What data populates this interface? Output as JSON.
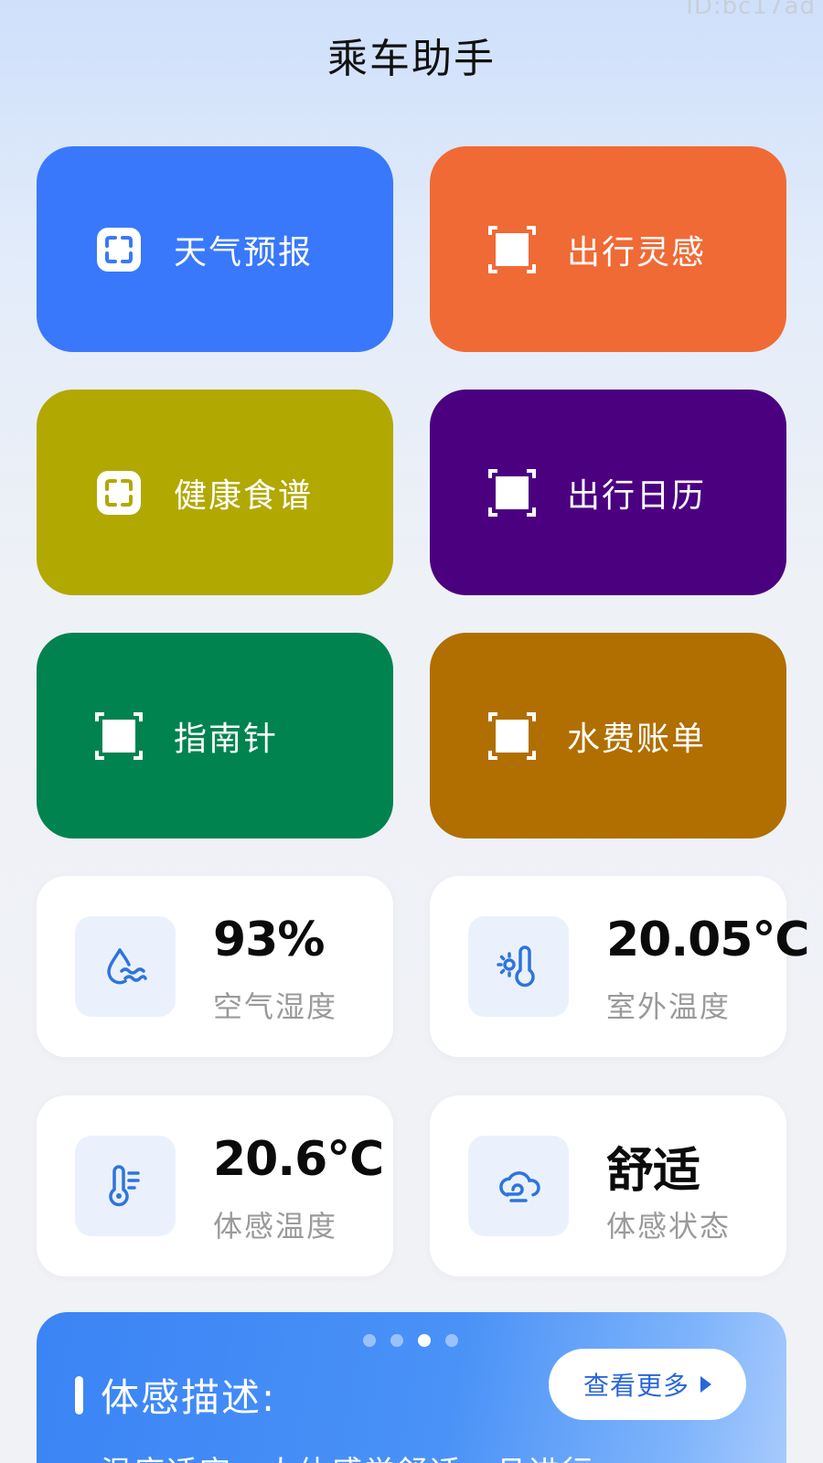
{
  "watermark": "ID:bc17ad",
  "app_title": "乘车助手",
  "tiles": [
    {
      "label": "天气预报",
      "color": "#3a78fb",
      "icon": "scan-frame-icon"
    },
    {
      "label": "出行灵感",
      "color": "#f06a35",
      "icon": "crop-square-icon"
    },
    {
      "label": "健康食谱",
      "color": "#b2a802",
      "icon": "scan-frame-icon"
    },
    {
      "label": "出行日历",
      "color": "#4b0080",
      "icon": "crop-square-icon"
    },
    {
      "label": "指南针",
      "color": "#00834f",
      "icon": "crop-square-icon"
    },
    {
      "label": "水费账单",
      "color": "#b06f00",
      "icon": "crop-square-icon"
    }
  ],
  "stats": [
    {
      "value": "93%",
      "label": "空气湿度",
      "icon": "humidity-drop-icon"
    },
    {
      "value": "20.05℃",
      "label": "室外温度",
      "icon": "sun-thermometer-icon"
    },
    {
      "value": "20.6℃",
      "label": "体感温度",
      "icon": "thermometer-icon"
    },
    {
      "value": "舒适",
      "label": "体感状态",
      "icon": "wind-cloud-icon"
    }
  ],
  "banner": {
    "heading": "体感描述:",
    "more_label": "查看更多",
    "description": "温度适宜，人体感觉舒适，且进行",
    "page_count": 4,
    "active_page": 3
  },
  "colors": {
    "accent": "#2a66d8",
    "stat_icon": "#2f74dc",
    "stat_icon_bg": "#eaf1fd"
  }
}
